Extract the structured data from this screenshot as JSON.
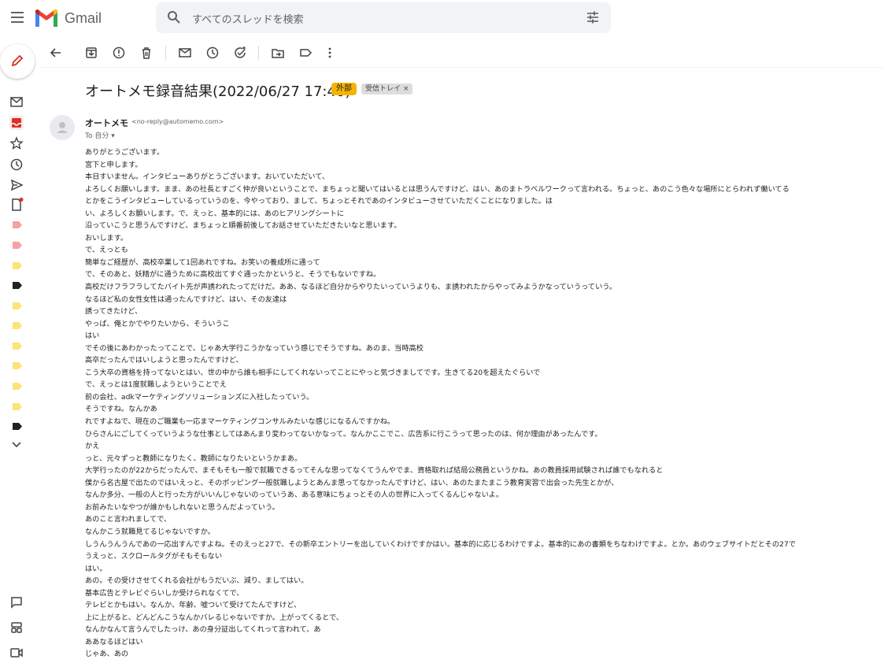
{
  "header": {
    "app_name": "Gmail",
    "search_placeholder": "すべてのスレッドを検索"
  },
  "colors": {
    "accent_red": "#d93025",
    "external_badge": "#f4b400",
    "label_pink": "#f7a1a1",
    "label_yellow": "#fce37a",
    "label_black": "#202124"
  },
  "rail": {
    "items": [
      "compose-icon",
      "mail-icon",
      "inbox-icon",
      "star-icon",
      "clock-icon",
      "send-icon",
      "draft-icon",
      "more-icon",
      "chat-icon",
      "spaces-icon",
      "meet-icon"
    ]
  },
  "toolbar": {
    "icons": [
      "back-icon",
      "archive-icon",
      "report-spam-icon",
      "delete-icon",
      "mark-unread-icon",
      "snooze-icon",
      "add-task-icon",
      "move-to-icon",
      "label-icon",
      "more-vert-icon"
    ]
  },
  "email": {
    "subject": "オートメモ録音結果(2022/06/27 17:40)",
    "badge_external": "外部",
    "badge_inbox": "受信トレイ ×",
    "sender_name": "オートメモ",
    "sender_email": "<no-reply@automemo.com>",
    "to_line": "To 自分 ▾",
    "body": [
      "ありがとうございます。",
      "宮下と申します。",
      "本日すいません。インタビューありがとうございます。おいていただいて、",
      "よろしくお願いします。まま、あの社長とすごく仲が良いということで、まちょっと聞いてはいるとは思うんですけど、はい、あのまトラベルワークって言われる。ちょっと、あのこう色々な場所にとらわれず働いてる",
      "とかをこうインタビューしているっていうのを、今やっており、まして、ちょっとそれであのインタビューさせていただくことになりました。は",
      "い、よろしくお願いします。で、えっと、基本的には、あのヒアリングシートに",
      "沿っていこうと思うんですけど、まちょっと順番前後してお話させていただきたいなと思います。",
      "おいします。",
      "で、えっとも",
      "簡単なご経歴が、高校卒業して1回あれですね。お笑いの養成所に通って",
      "で、そのあと、妖精がに通うために高校出てすぐ通ったかというと、そうでもないですね。",
      "高校だけフラフラしてたバイト先が声誘われたってだけだ。ああ、なるほど自分からやりたいっていうよりも、ま誘われたからやってみようかなっていうっていう。",
      "なるほど私の女性女性は通ったんですけど、はい、その友達は",
      "誘ってきたけど、",
      "やっぱ、俺とかでやりたいから、そういうこ",
      "はい",
      "でその後にあわかったってことで、じゃあ大学行こうかなっていう感じでそうですね。あのま、当時高校",
      "高卒だったんではいしようと思ったんですけど、",
      "こう大卒の資格を持ってないとはい、世の中から誰も相手にしてくれないってことにやっと気づきましてです。生きてる20を超えたぐらいで",
      "で、えっとは1度就職しようということでえ",
      "前の会社、adkマーケティングソリューションズに入社したっていう。",
      "そうですね。なんかあ",
      "れですよねで、現在のご職業も一応まマーケティングコンサルみたいな感じになるんですかね。",
      "ひらさんにごしてくっていうような仕事としてはあんまり変わってないかなって。なんかここでこ、広告系に行こうって思ったのは、何か理由があったんです。",
      "かえ",
      "っと、元々ずっと教師になりたく、教師になりたいというかまあ。",
      "大学行ったのが22からだったんで、まそもそも一般で就職できるってそんな思ってなくてうんやでま、資格取れば結局公務員というかね。あの教員採用試験されば誰でもなれると",
      "僕から名古屋で出たのではいえっと、そのポッピング一般就職しようとあんま思ってなかったんですけど、はい、あのたまたまこう教育実習で出会った先生とかが、",
      "なんか多分、一般の人と行った方がいいんじゃないのっていうあ、ある意味にちょっとその人の世界に入ってくるんじゃないよ。",
      "お前みたいなやつが誰かもしれないと思うんだよっていう。",
      "あのこと言われましてで、",
      "なんかこう就職見てるじゃないですか。",
      "しうんうんうんであの一応出すんですよね。そのえっと27で、その新卒エントリーを出していくわけですかはい。基本的に応じるわけですよ。基本的にあの書類をちなわけですよ。とか。あのウェブサイトだとその27で",
      "うえっと、スクロールタグがそもそもない",
      "はい。",
      "あの。その受けさせてくれる会社がもうだいぶ、減り、ましてはい。",
      "基本広告とテレビぐらいしか受けられなくてで、",
      "テレビとかもはい。なんか、年齢、嘘ついて受けてたんですけど、",
      "上に上がると、どんどんこうなんかバレるじゃないですか。上がってくるとで、",
      "なんかなんて言うんでしたっけ、あの身分証出してくれって言われて、あ",
      "ああなるほどはい",
      "じゃあ、あの"
    ]
  }
}
